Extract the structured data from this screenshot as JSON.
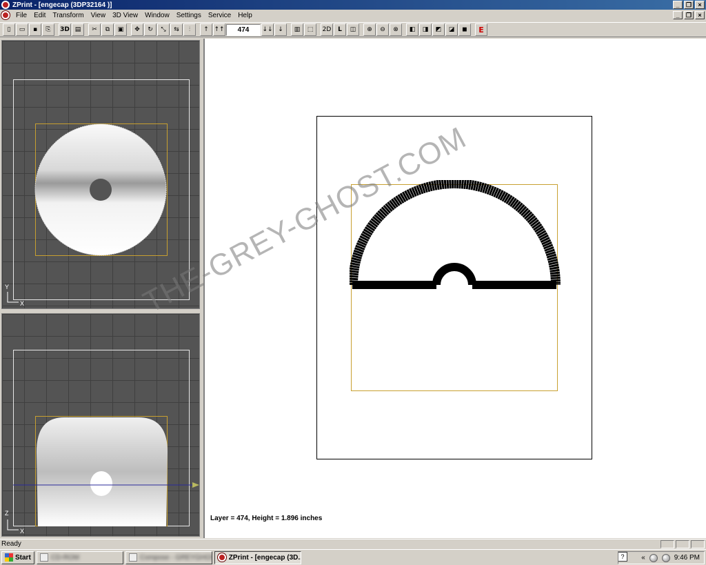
{
  "window": {
    "title": "ZPrint - [engecap (3DP32164 )]"
  },
  "menu": {
    "items": [
      {
        "label": "File",
        "accel": "F"
      },
      {
        "label": "Edit",
        "accel": "E"
      },
      {
        "label": "Transform",
        "accel": "T"
      },
      {
        "label": "View",
        "accel": "V"
      },
      {
        "label": "3D View",
        "accel": ""
      },
      {
        "label": "Window",
        "accel": ""
      },
      {
        "label": "Settings",
        "accel": ""
      },
      {
        "label": "Service",
        "accel": ""
      },
      {
        "label": "Help",
        "accel": "H"
      }
    ]
  },
  "toolbar": {
    "layer_value": "474",
    "btn_3d": "3D",
    "btn_2d": "2D",
    "btn_l": "L",
    "btn_e": "E",
    "arrow_up": "↑",
    "arrow_up_double": "↑↑",
    "arrow_down_double": "↓↓",
    "arrow_down": "↓"
  },
  "views": {
    "top_axis_y": "Y",
    "top_axis_x": "X",
    "front_axis_z": "Z",
    "front_axis_x": "X"
  },
  "main": {
    "layer_readout": "Layer = 474,  Height = 1.896 inches",
    "watermark": "THE-GREY-GHOST.COM"
  },
  "status": {
    "text": "Ready"
  },
  "taskbar": {
    "start_label": "Start",
    "task_active": "ZPrint - [engecap (3D...",
    "task_blurred_1": "CD-ROM",
    "task_blurred_2": "Compose - GREYGHOST",
    "clock": "9:46 PM",
    "help_glyph": "?",
    "tray_chevron": "«"
  },
  "colors": {
    "titlebar": "#0a246a",
    "viewport_bg": "#545454",
    "bbox": "#c8a030"
  }
}
